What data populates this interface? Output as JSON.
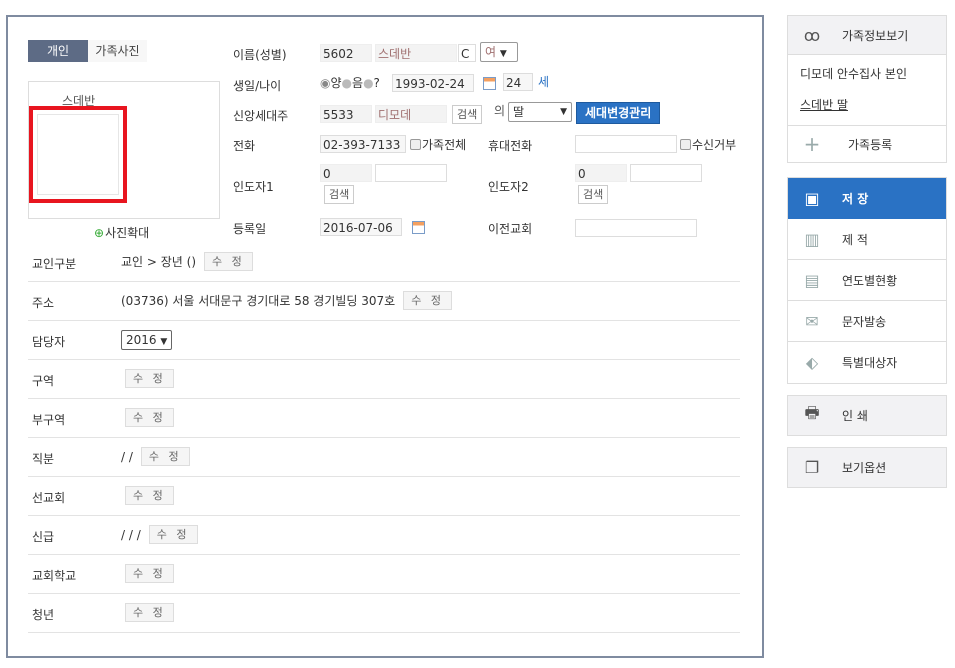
{
  "tabs": {
    "personal": "개인",
    "family_photo": "가족사진"
  },
  "photo": {
    "name": "스데반",
    "zoom_label": "사진확대"
  },
  "form": {
    "name_label": "이름(성별)",
    "name_id": "5602",
    "name_value": "스데반",
    "name_suffix": "C",
    "gender": "여",
    "birth_label": "생일/나이",
    "radio_solar": "양",
    "radio_lunar": "음",
    "radio_unknown": "?",
    "birth_date": "1993-02-24",
    "age": "24",
    "age_unit": "세",
    "head_label": "신앙세대주",
    "head_id": "5533",
    "head_name": "디모데",
    "search": "검색",
    "of": "의",
    "relation": "딸",
    "household_btn": "세대변경관리",
    "phone_label": "전화",
    "phone": "02-393-7133",
    "family_all": "가족전체",
    "mobile_label": "휴대전화",
    "mobile": "",
    "reject": "수신거부",
    "guide1_label": "인도자1",
    "guide1_id": "0",
    "guide2_label": "인도자2",
    "guide2_id": "0",
    "reg_label": "등록일",
    "reg_date": "2016-07-06",
    "prev_church_label": "이전교회"
  },
  "edit": "수 정",
  "rows": [
    {
      "label": "교인구분",
      "value": "교인 > 장년 ()"
    },
    {
      "label": "주소",
      "value": "(03736) 서울 서대문구 경기대로 58 경기빌딩 307호"
    },
    {
      "label": "담당자",
      "select": "2016"
    },
    {
      "label": "구역",
      "value": ""
    },
    {
      "label": "부구역",
      "value": ""
    },
    {
      "label": "직분",
      "value": "/ /"
    },
    {
      "label": "선교회",
      "value": ""
    },
    {
      "label": "신급",
      "value": "/ / /"
    },
    {
      "label": "교회학교",
      "value": ""
    },
    {
      "label": "청년",
      "value": ""
    }
  ],
  "side": {
    "family_view": "가족정보보기",
    "member1": "디모데 안수집사 본인",
    "member2": "스데반 딸",
    "family_add": "가족등록",
    "save": "저 장",
    "remove": "제 적",
    "yearly": "연도별현황",
    "sms": "문자발송",
    "special": "특별대상자",
    "print": "인 쇄",
    "view_options": "보기옵션"
  },
  "colors": {
    "accent": "#2a72c4",
    "tab_active": "#5d6b85"
  }
}
